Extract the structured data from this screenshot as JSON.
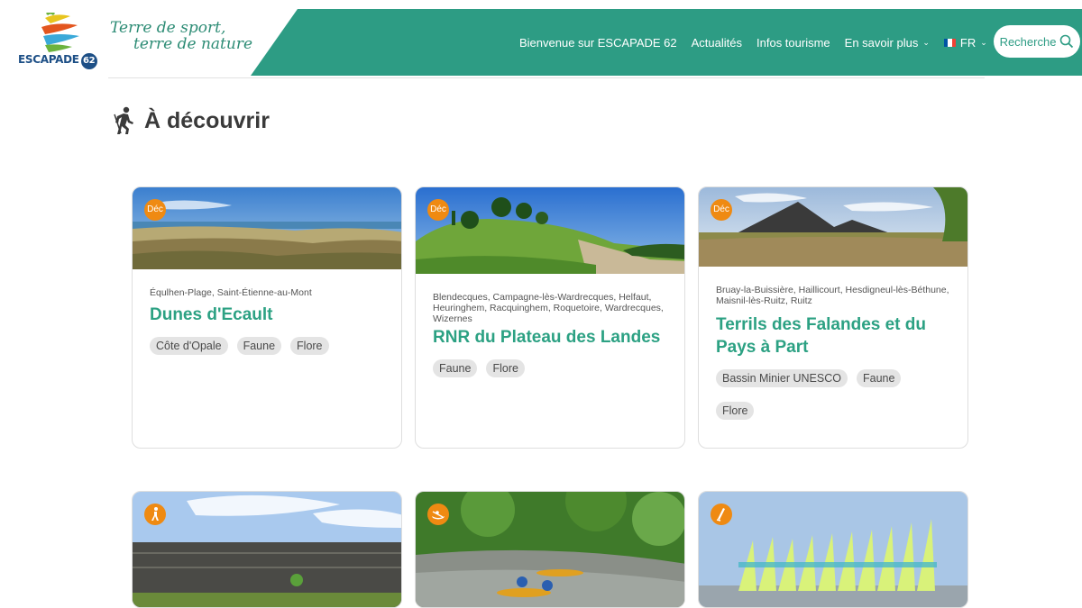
{
  "header": {
    "logo_text": "ESCAPADE",
    "logo_number": "62",
    "tagline_line1": "Terre de sport,",
    "tagline_line2": "terre de nature",
    "nav": [
      {
        "label": "Bienvenue sur ESCAPADE 62"
      },
      {
        "label": "Actualités"
      },
      {
        "label": "Infos tourisme"
      },
      {
        "label": "En savoir plus"
      },
      {
        "label": "FR"
      }
    ],
    "search_label": "Recherche"
  },
  "section": {
    "title": "À découvrir"
  },
  "colors": {
    "brand_green": "#2d9c84",
    "title_green": "#2ca183",
    "badge_orange": "#ef8a12"
  },
  "cards": [
    {
      "badge": "Déc",
      "location": "Équlhen-Plage, Saint-Étienne-au-Mont",
      "title": "Dunes d'Ecault",
      "tags": [
        "Côte d'Opale",
        "Faune",
        "Flore"
      ]
    },
    {
      "badge": "Déc",
      "location": "Blendecques, Campagne-lès-Wardrecques, Helfaut, Heuringhem, Racquinghem, Roquetoire, Wardrecques, Wizernes",
      "title": "RNR du Plateau des Landes",
      "tags": [
        "Faune",
        "Flore"
      ]
    },
    {
      "badge": "Déc",
      "location": "Bruay-la-Buissière, Haillicourt, Hesdigneul-lès-Béthune, Maisnil-lès-Ruitz, Ruitz",
      "title": "Terrils des Falandes et du Pays à Part",
      "tags": [
        "Bassin Minier UNESCO",
        "Faune",
        "Flore"
      ]
    },
    {
      "badge_icon": "hiker-icon"
    },
    {
      "badge_icon": "canoe-icon"
    },
    {
      "badge_icon": "sail-icon"
    }
  ]
}
